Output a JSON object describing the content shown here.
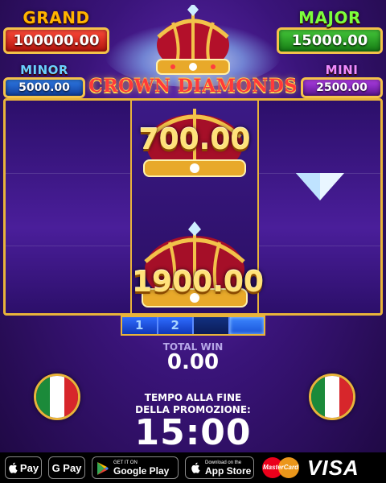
{
  "jackpots": {
    "grand": {
      "title": "GRAND",
      "value": "100000.00"
    },
    "major": {
      "title": "MAJOR",
      "value": "15000.00"
    },
    "minor": {
      "title": "MINOR",
      "value": "5000.00"
    },
    "mini": {
      "title": "MINI",
      "value": "2500.00"
    }
  },
  "logo": "CROWN DIAMONDS",
  "reels": {
    "crown_values": [
      "700.00",
      "1900.00"
    ]
  },
  "progress": {
    "segments": [
      "1",
      "2",
      "",
      ""
    ]
  },
  "total_win": {
    "label": "TOTAL WIN",
    "value": "0.00"
  },
  "promo": {
    "label_line1": "TEMPO ALLA FINE",
    "label_line2": "DELLA PROMOZIONE:",
    "timer": "15:00"
  },
  "flags": {
    "country": "Italy",
    "colors": [
      "#1b8a3a",
      "#ffffff",
      "#d7262b"
    ]
  },
  "payments": {
    "apple_pay": "Pay",
    "google_pay": "G Pay",
    "google_play_small": "GET IT ON",
    "google_play_big": "Google Play",
    "app_store_small": "Download on the",
    "app_store_big": "App Store",
    "mastercard": "MasterCard",
    "visa": "VISA"
  },
  "colors": {
    "gold": "#e9b43a",
    "background": "#3a147a",
    "grand": "#d42a1e",
    "major": "#2aa020",
    "minor": "#1f5ec4",
    "mini": "#8a2ac0"
  }
}
